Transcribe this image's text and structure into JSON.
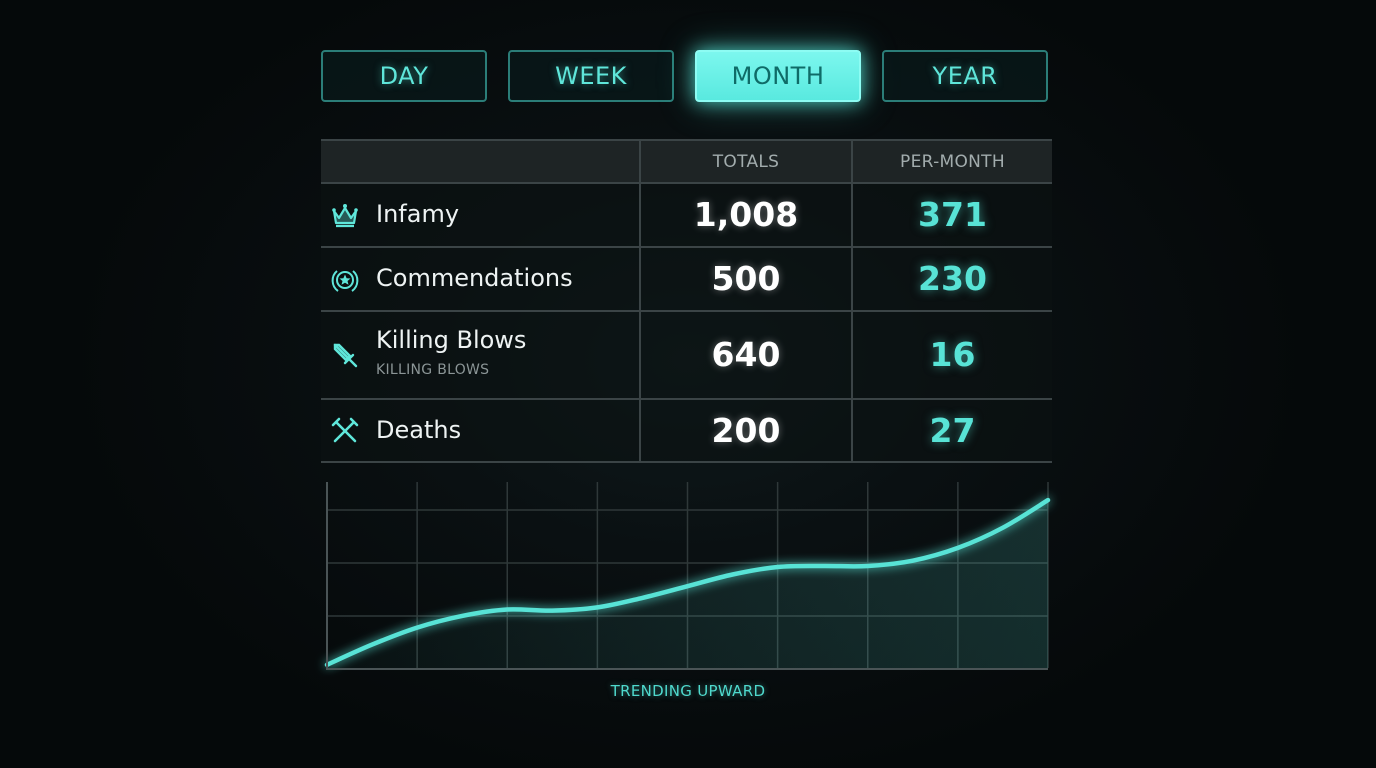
{
  "tabs": [
    {
      "label": "DAY",
      "active": false
    },
    {
      "label": "WEEK",
      "active": false
    },
    {
      "label": "MONTH",
      "active": true
    },
    {
      "label": "YEAR",
      "active": false
    }
  ],
  "table": {
    "headers": {
      "name": "",
      "totals": "TOTALS",
      "per_period": "PER-MONTH"
    },
    "rows": [
      {
        "icon": "crown-icon",
        "name": "Infamy",
        "subtitle": "",
        "total": "1,008",
        "per_period": "371"
      },
      {
        "icon": "star-laurel-icon",
        "name": "Commendations",
        "subtitle": "",
        "total": "500",
        "per_period": "230"
      },
      {
        "icon": "sword-icon",
        "name": "Killing Blows",
        "subtitle": "KILLING BLOWS",
        "total": "640",
        "per_period": "16"
      },
      {
        "icon": "crossed-hammers-icon",
        "name": "Deaths",
        "subtitle": "",
        "total": "200",
        "per_period": "27"
      }
    ]
  },
  "colors": {
    "accent": "#58e3d6",
    "grid": "#2f3839",
    "divider": "#3b4446"
  },
  "chart_data": {
    "type": "area",
    "title": "",
    "xlabel": "",
    "ylabel": "",
    "grid": true,
    "x": [
      0,
      0.5,
      1,
      1.5,
      2,
      2.5,
      3,
      3.5,
      4,
      4.5,
      5,
      5.5,
      6,
      6.5,
      7,
      7.5,
      8
    ],
    "values": [
      0.3,
      2.2,
      3.8,
      4.9,
      5.5,
      5.4,
      5.7,
      6.6,
      7.7,
      8.8,
      9.5,
      9.6,
      9.6,
      10.1,
      11.3,
      13.2,
      15.8
    ],
    "ylim": [
      0,
      17.5
    ],
    "xlim": [
      0,
      8
    ],
    "caption": "TRENDING UPWARD"
  }
}
